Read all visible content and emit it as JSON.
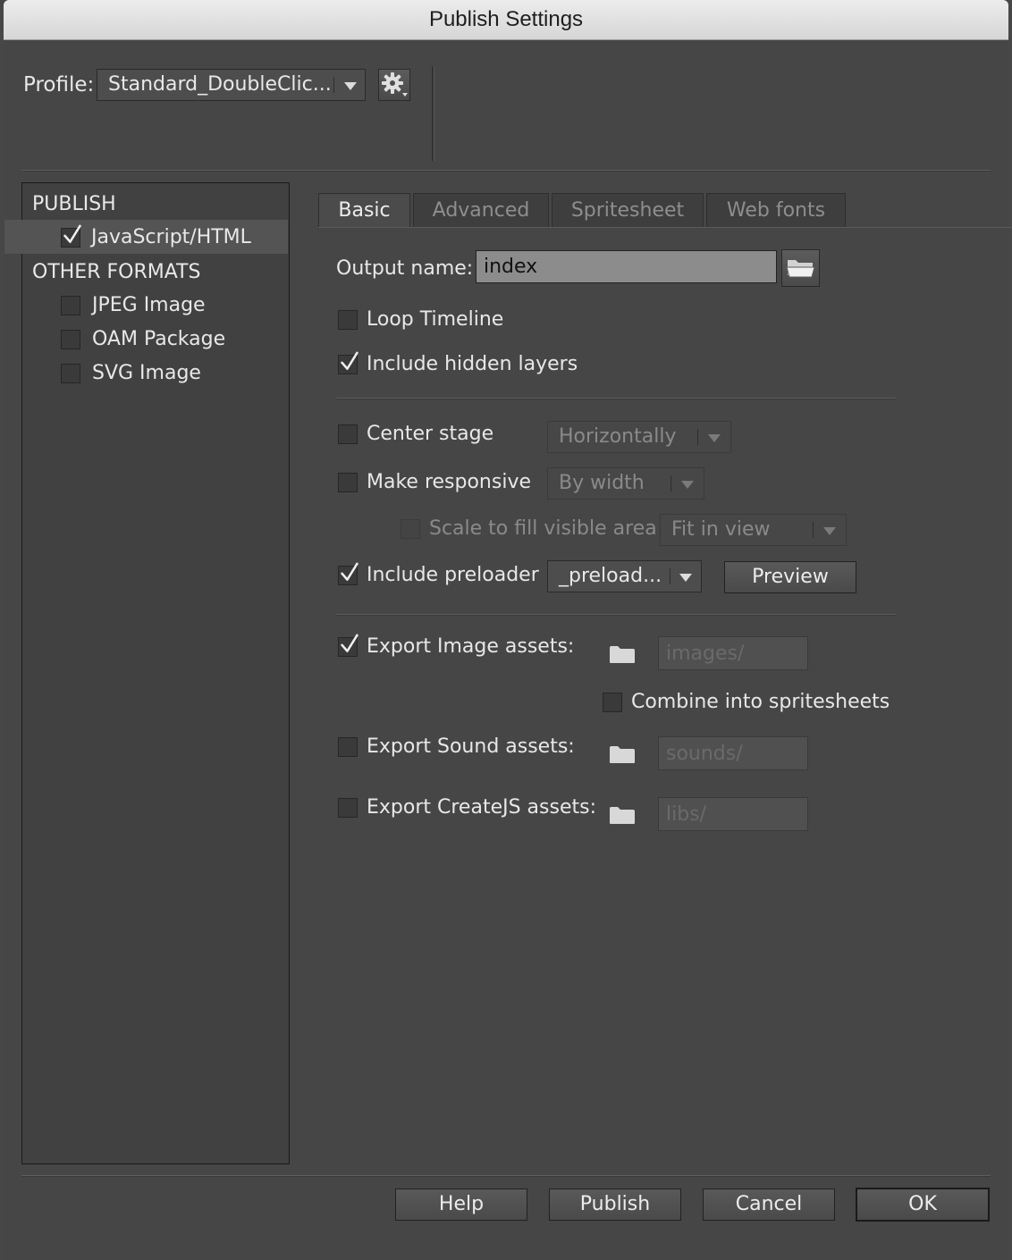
{
  "window": {
    "title": "Publish Settings"
  },
  "profile": {
    "label": "Profile:",
    "value": "Standard_DoubleClic...",
    "settings_icon": "gear-icon"
  },
  "sidebar": {
    "publish_header": "PUBLISH",
    "publish_items": [
      {
        "label": "JavaScript/HTML",
        "checked": true
      }
    ],
    "other_header": "OTHER FORMATS",
    "other_items": [
      {
        "label": "JPEG Image",
        "checked": false
      },
      {
        "label": "OAM Package",
        "checked": false
      },
      {
        "label": "SVG Image",
        "checked": false
      }
    ]
  },
  "tabs": [
    {
      "label": "Basic",
      "active": true
    },
    {
      "label": "Advanced",
      "active": false
    },
    {
      "label": "Spritesheet",
      "active": false
    },
    {
      "label": "Web fonts",
      "active": false
    }
  ],
  "basic": {
    "output_name_label": "Output name:",
    "output_name_value": "index",
    "loop_timeline": {
      "label": "Loop Timeline",
      "checked": false
    },
    "include_hidden_layers": {
      "label": "Include hidden layers",
      "checked": true
    },
    "center_stage": {
      "label": "Center stage",
      "checked": false,
      "option": "Horizontally"
    },
    "make_responsive": {
      "label": "Make responsive",
      "checked": false,
      "option": "By width"
    },
    "scale_to_fill": {
      "label": "Scale to fill visible area",
      "checked": false,
      "option": "Fit in view"
    },
    "include_preloader": {
      "label": "Include preloader",
      "checked": true,
      "option": "_preload...",
      "preview_label": "Preview"
    },
    "export_image": {
      "label": "Export Image assets:",
      "checked": true,
      "path_placeholder": "images/"
    },
    "combine_spritesheets": {
      "label": "Combine into spritesheets",
      "checked": false
    },
    "export_sound": {
      "label": "Export Sound assets:",
      "checked": false,
      "path_placeholder": "sounds/"
    },
    "export_createjs": {
      "label": "Export CreateJS assets:",
      "checked": false,
      "path_placeholder": "libs/"
    }
  },
  "footer": {
    "help": "Help",
    "publish": "Publish",
    "cancel": "Cancel",
    "ok": "OK"
  }
}
